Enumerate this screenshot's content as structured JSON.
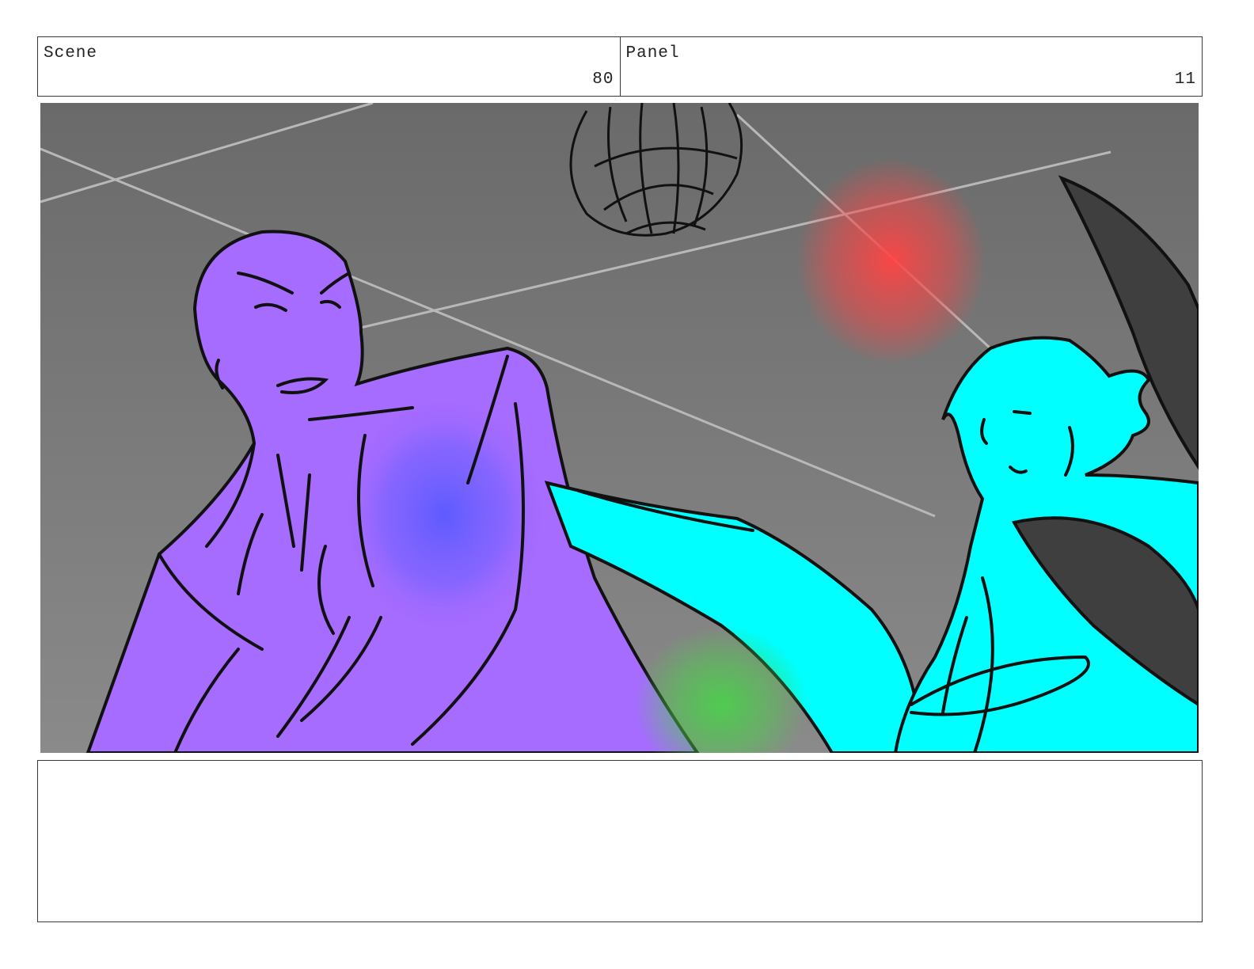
{
  "header": {
    "scene_label": "Scene",
    "scene_number": "80",
    "panel_label": "Panel",
    "panel_number": "11"
  },
  "notes": {
    "text": ""
  },
  "colors": {
    "background_gray": "#7a7a7a",
    "purple_character": "#a66bff",
    "cyan_character": "#00ffff",
    "red_light": "#ff4444",
    "blue_light": "#5a5aff",
    "green_light": "#4ccf4c",
    "dark_shape": "#3f3f3f"
  }
}
